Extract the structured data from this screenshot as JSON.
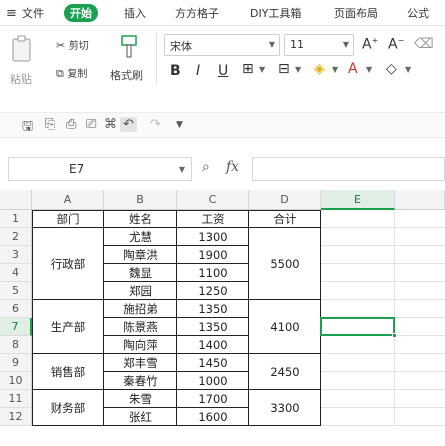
{
  "menubar": {
    "file": "文件",
    "home": "开始",
    "insert": "插入",
    "grid": "方方格子",
    "diy": "DIY工具箱",
    "layout": "页面布局",
    "formula": "公式"
  },
  "ribbon": {
    "paste": "粘贴",
    "cut": "剪切",
    "copy": "复制",
    "format_painter": "格式刷",
    "font_name": "宋体",
    "font_size": "11"
  },
  "formula_bar": {
    "name_box": "E7",
    "fx": "fx"
  },
  "sheet": {
    "columns": [
      "A",
      "B",
      "C",
      "D",
      "E"
    ],
    "rows": [
      "1",
      "2",
      "3",
      "4",
      "5",
      "6",
      "7",
      "8",
      "9",
      "10",
      "11",
      "12"
    ],
    "headers": {
      "dept": "部门",
      "name": "姓名",
      "salary": "工资",
      "total": "合计"
    },
    "groups": [
      {
        "dept": "行政部",
        "total": "5500",
        "people": [
          {
            "name": "尤慧",
            "salary": "1300"
          },
          {
            "name": "陶章洪",
            "salary": "1900"
          },
          {
            "name": "魏显",
            "salary": "1100"
          },
          {
            "name": "郑园",
            "salary": "1250"
          }
        ]
      },
      {
        "dept": "生产部",
        "total": "4100",
        "people": [
          {
            "name": "施招弟",
            "salary": "1350"
          },
          {
            "name": "陈景燕",
            "salary": "1350"
          },
          {
            "name": "陶向萍",
            "salary": "1400"
          }
        ]
      },
      {
        "dept": "销售部",
        "total": "2450",
        "people": [
          {
            "name": "郑丰雪",
            "salary": "1450"
          },
          {
            "name": "秦春竹",
            "salary": "1000"
          }
        ]
      },
      {
        "dept": "财务部",
        "total": "3300",
        "people": [
          {
            "name": "朱雪",
            "salary": "1700"
          },
          {
            "name": "张红",
            "salary": "1600"
          }
        ]
      }
    ]
  },
  "colors": {
    "accent": "#1aa04e"
  }
}
